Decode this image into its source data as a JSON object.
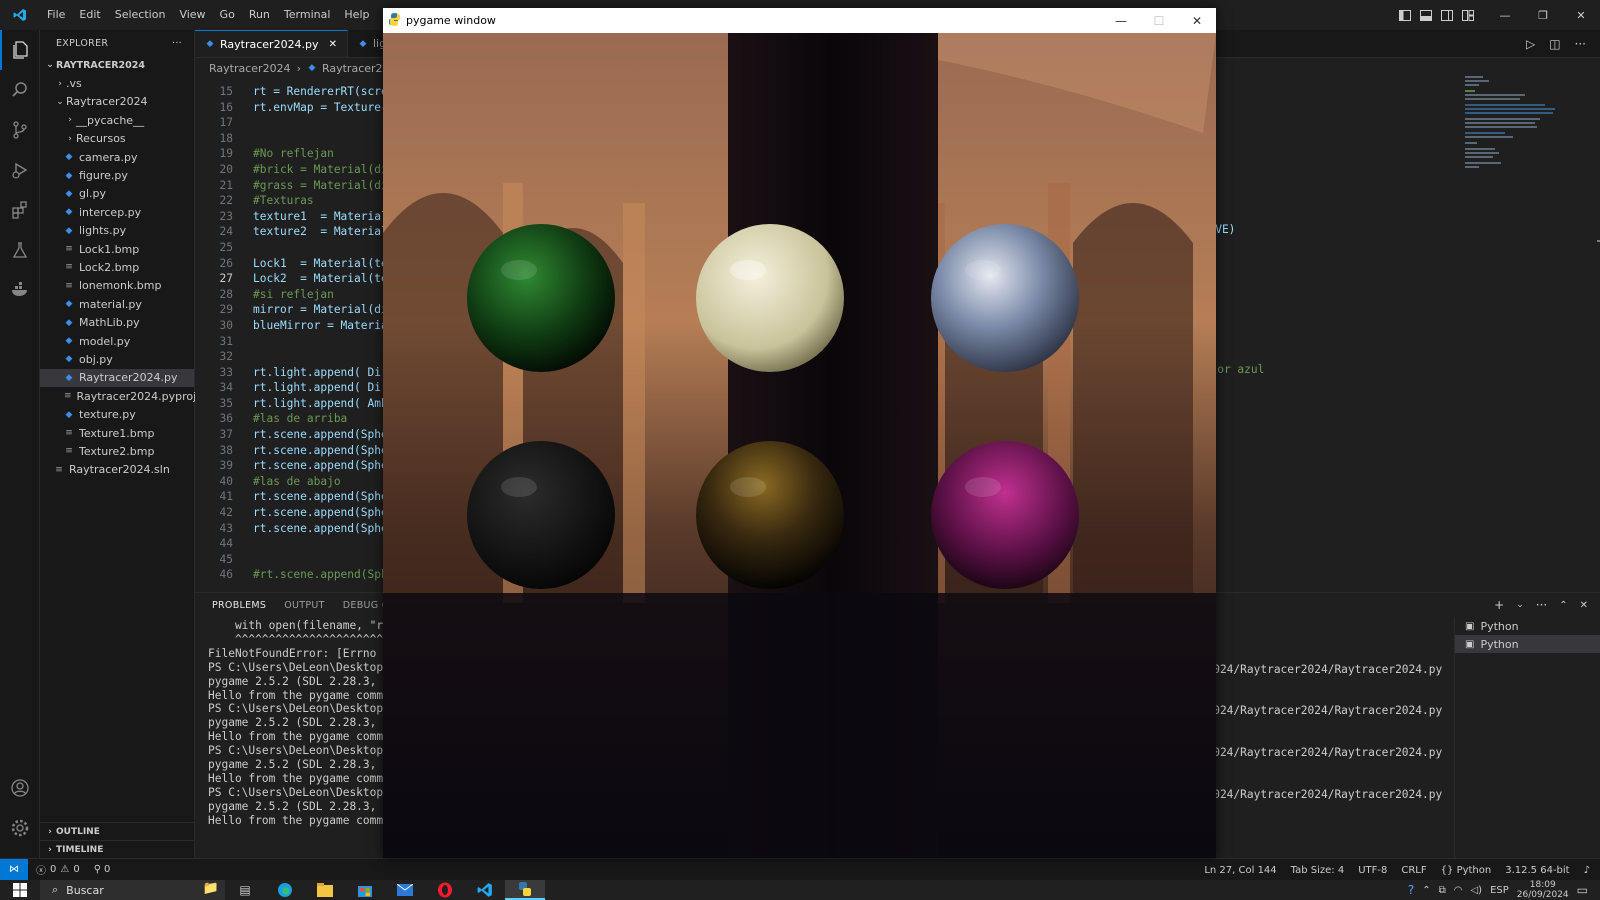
{
  "menu": [
    "File",
    "Edit",
    "Selection",
    "View",
    "Go",
    "Run",
    "Terminal",
    "Help"
  ],
  "window_controls": {
    "minimize": "—",
    "restore": "❐",
    "close": "✕"
  },
  "explorer": {
    "title": "EXPLORER",
    "root": "RAYTRACER2024",
    "items": [
      {
        "label": ".vs",
        "kind": "folder",
        "indent": 1
      },
      {
        "label": "Raytracer2024",
        "kind": "folder-open",
        "indent": 1
      },
      {
        "label": "__pycache__",
        "kind": "folder",
        "indent": 2
      },
      {
        "label": "Recursos",
        "kind": "folder",
        "indent": 2
      },
      {
        "label": "camera.py",
        "kind": "py",
        "indent": 2
      },
      {
        "label": "figure.py",
        "kind": "py",
        "indent": 2
      },
      {
        "label": "gl.py",
        "kind": "py",
        "indent": 2
      },
      {
        "label": "intercep.py",
        "kind": "py",
        "indent": 2
      },
      {
        "label": "lights.py",
        "kind": "py",
        "indent": 2
      },
      {
        "label": "Lock1.bmp",
        "kind": "txt",
        "indent": 2
      },
      {
        "label": "Lock2.bmp",
        "kind": "txt",
        "indent": 2
      },
      {
        "label": "lonemonk.bmp",
        "kind": "txt",
        "indent": 2
      },
      {
        "label": "material.py",
        "kind": "py",
        "indent": 2
      },
      {
        "label": "MathLib.py",
        "kind": "py",
        "indent": 2
      },
      {
        "label": "model.py",
        "kind": "py",
        "indent": 2
      },
      {
        "label": "obj.py",
        "kind": "py",
        "indent": 2
      },
      {
        "label": "Raytracer2024.py",
        "kind": "py",
        "indent": 2,
        "selected": true
      },
      {
        "label": "Raytracer2024.pyproj",
        "kind": "txt",
        "indent": 2
      },
      {
        "label": "texture.py",
        "kind": "py",
        "indent": 2
      },
      {
        "label": "Texture1.bmp",
        "kind": "txt",
        "indent": 2
      },
      {
        "label": "Texture2.bmp",
        "kind": "txt",
        "indent": 2
      },
      {
        "label": "Raytracer2024.sln",
        "kind": "txt",
        "indent": 1
      }
    ],
    "outline": "OUTLINE",
    "timeline": "TIMELINE"
  },
  "tabs": [
    {
      "label": "Raytracer2024.py",
      "close": "✕",
      "active": true
    },
    {
      "label": "lights",
      "active": false
    }
  ],
  "breadcrumb": {
    "folder": "Raytracer2024",
    "sep": "›",
    "file": "Raytracer2024."
  },
  "code": [
    {
      "n": "15",
      "t": "rt = RendererRT(scre",
      "c": "kw"
    },
    {
      "n": "16",
      "t": "rt.envMap = Texture(",
      "c": "kw"
    },
    {
      "n": "17",
      "t": "",
      "c": "kw"
    },
    {
      "n": "18",
      "t": "",
      "c": "kw"
    },
    {
      "n": "19",
      "t": "#No reflejan",
      "c": "cm"
    },
    {
      "n": "20",
      "t": "#brick = Material(di",
      "c": "cm"
    },
    {
      "n": "21",
      "t": "#grass = Material(di",
      "c": "cm"
    },
    {
      "n": "22",
      "t": "#Texturas",
      "c": "cm"
    },
    {
      "n": "23",
      "t": "texture1  = Material",
      "c": "kw"
    },
    {
      "n": "24",
      "t": "texture2  = Material",
      "c": "kw"
    },
    {
      "n": "25",
      "t": "",
      "c": "kw"
    },
    {
      "n": "26",
      "t": "Lock1  = Material(te",
      "c": "kw"
    },
    {
      "n": "27",
      "t": "Lock2  = Material(te",
      "c": "kw",
      "cur": true
    },
    {
      "n": "28",
      "t": "#si reflejan",
      "c": "cm"
    },
    {
      "n": "29",
      "t": "mirror = Material(di",
      "c": "kw"
    },
    {
      "n": "30",
      "t": "blueMirror = Materia",
      "c": "kw"
    },
    {
      "n": "31",
      "t": "",
      "c": "kw"
    },
    {
      "n": "32",
      "t": "",
      "c": "kw"
    },
    {
      "n": "33",
      "t": "rt.light.append( Dir",
      "c": "kw"
    },
    {
      "n": "34",
      "t": "rt.light.append( Dir",
      "c": "kw"
    },
    {
      "n": "35",
      "t": "rt.light.append( Amb",
      "c": "kw"
    },
    {
      "n": "36",
      "t": "#las de arriba",
      "c": "cm"
    },
    {
      "n": "37",
      "t": "rt.scene.append(Sphe",
      "c": "kw"
    },
    {
      "n": "38",
      "t": "rt.scene.append(Sphe",
      "c": "kw"
    },
    {
      "n": "39",
      "t": "rt.scene.append(Sphe",
      "c": "kw"
    },
    {
      "n": "40",
      "t": "#las de abajo",
      "c": "cm"
    },
    {
      "n": "41",
      "t": "rt.scene.append(Sphe",
      "c": "kw"
    },
    {
      "n": "42",
      "t": "rt.scene.append(Sphe",
      "c": "kw"
    },
    {
      "n": "43",
      "t": "rt.scene.append(Sphe",
      "c": "kw"
    },
    {
      "n": "44",
      "t": "",
      "c": "kw"
    },
    {
      "n": "45",
      "t": "",
      "c": "kw"
    },
    {
      "n": "46",
      "t": "#rt.scene.append(Sph",
      "c": "cm"
    }
  ],
  "code_right_fragments": {
    "line23": "CTIVE)",
    "line30": "color azul"
  },
  "panel": {
    "tabs": [
      "PROBLEMS",
      "OUTPUT",
      "DEBUG CON"
    ],
    "terminal": [
      "    with open(filename, \"r",
      "    ^^^^^^^^^^^^^^^^^^^^^^",
      "FileNotFoundError: [Errno",
      "PS C:\\Users\\DeLeon\\Desktop",
      "pygame 2.5.2 (SDL 2.28.3,",
      "Hello from the pygame comm",
      "PS C:\\Users\\DeLeon\\Desktop",
      "pygame 2.5.2 (SDL 2.28.3,",
      "Hello from the pygame comm",
      "PS C:\\Users\\DeLeon\\Desktop",
      "pygame 2.5.2 (SDL 2.28.3,",
      "Hello from the pygame comm",
      "PS C:\\Users\\DeLeon\\Desktop",
      "pygame 2.5.2 (SDL 2.28.3,",
      "Hello from the pygame comm"
    ],
    "terminal_right": "er2024/Raytracer2024/Raytracer2024.py",
    "terminals": [
      "Python",
      "Python"
    ]
  },
  "status": {
    "errors": "0",
    "warnings": "0",
    "ports": "0",
    "position": "Ln 27, Col 144",
    "tabsize": "Tab Size: 4",
    "encoding": "UTF-8",
    "eol": "CRLF",
    "language": "Python",
    "interpreter": "3.12.5 64-bit"
  },
  "pygame": {
    "title": "pygame window",
    "spheres": [
      {
        "name": "green",
        "color": "#1e6b22"
      },
      {
        "name": "white",
        "color": "#e8e4cc"
      },
      {
        "name": "marble",
        "color": "#8a9ab5"
      },
      {
        "name": "dark-mirror",
        "color": "#1a1a1a"
      },
      {
        "name": "gold-mirror",
        "color": "#5a4a1a"
      },
      {
        "name": "magenta",
        "color": "#8a1a6a"
      }
    ]
  },
  "taskbar": {
    "search": "Buscar",
    "lang": "ESP",
    "time": "18:09",
    "date": "26/09/2024"
  }
}
